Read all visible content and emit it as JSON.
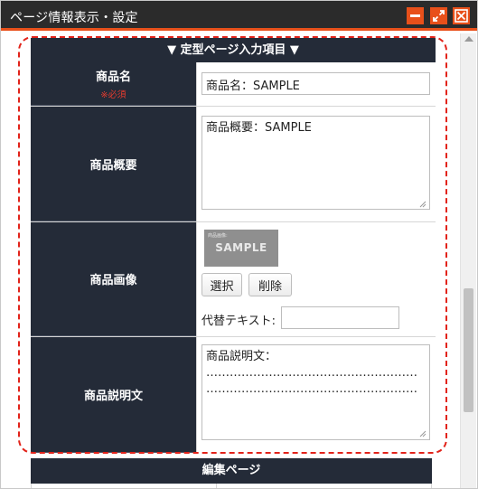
{
  "window": {
    "title": "ページ情報表示・設定",
    "accent_color": "#e8501a",
    "titlebar_color": "#2b2b2b",
    "controls": {
      "minimize_icon": "minimize-icon",
      "maximize_icon": "expand-icon",
      "close_icon": "close-x-icon"
    }
  },
  "section": {
    "heading": "▼ 定型ページ入力項目 ▼",
    "label_bg": "#242b38"
  },
  "fields": {
    "product_name": {
      "label": "商品名",
      "required_note": "※必須",
      "value": "商品名：SAMPLE"
    },
    "product_summary": {
      "label": "商品概要",
      "value": "商品概要：SAMPLE"
    },
    "product_image": {
      "label": "商品画像",
      "thumb_caption": "商品画像:",
      "thumb_text": "SAMPLE",
      "select_button": "選択",
      "delete_button": "削除",
      "alt_label": "代替テキスト:",
      "alt_value": ""
    },
    "product_description": {
      "label": "商品説明文",
      "value": "商品説明文：\n………………………………………………\n………………………………………………"
    }
  },
  "next_section": {
    "heading": "編集ページ"
  },
  "highlight_color": "#e2231a"
}
